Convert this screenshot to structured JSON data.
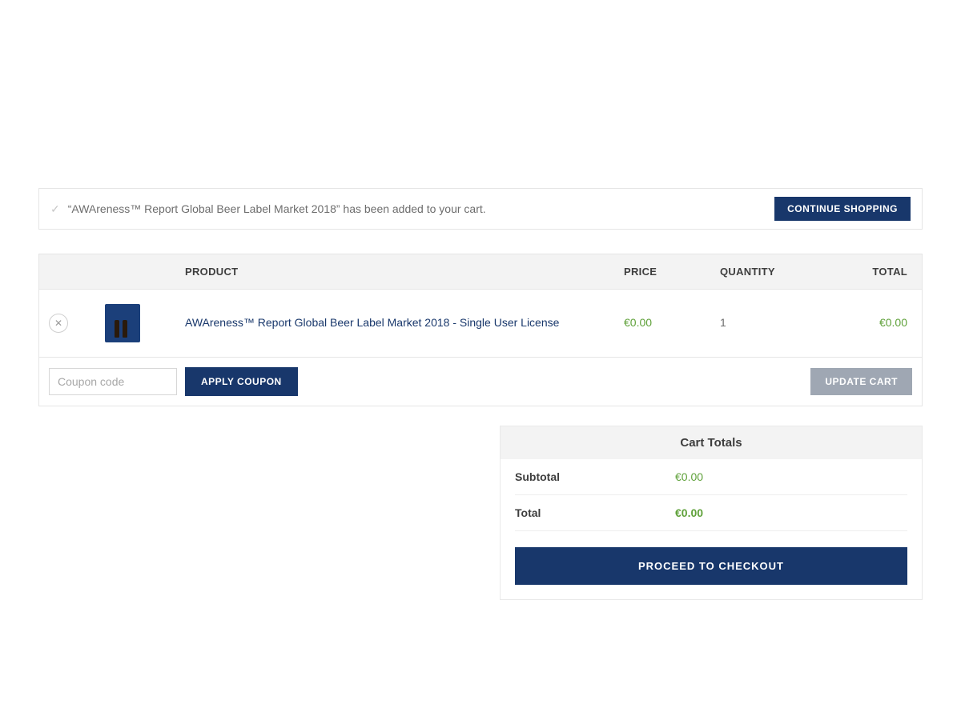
{
  "notice": {
    "message": "“AWAreness™ Report Global Beer Label Market 2018” has been added to your cart.",
    "continue_label": "CONTINUE SHOPPING"
  },
  "cart": {
    "headers": {
      "product": "PRODUCT",
      "price": "PRICE",
      "qty": "QUANTITY",
      "total": "TOTAL"
    },
    "items": [
      {
        "name": "AWAreness™ Report Global Beer Label Market 2018 - Single User License",
        "price": "€0.00",
        "qty": "1",
        "total": "€0.00"
      }
    ],
    "coupon": {
      "placeholder": "Coupon code",
      "apply_label": "APPLY COUPON"
    },
    "update_label": "UPDATE CART"
  },
  "totals": {
    "title": "Cart Totals",
    "subtotal_label": "Subtotal",
    "subtotal_value": "€0.00",
    "total_label": "Total",
    "total_value": "€0.00",
    "checkout_label": "PROCEED TO CHECKOUT"
  }
}
